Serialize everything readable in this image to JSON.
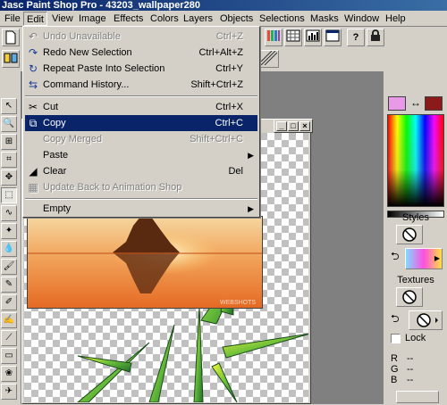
{
  "app": {
    "title": "Jasc Paint Shop Pro - 43203_wallpaper280"
  },
  "menubar": {
    "items": [
      {
        "label": "File"
      },
      {
        "label": "Edit"
      },
      {
        "label": "View"
      },
      {
        "label": "Image"
      },
      {
        "label": "Effects"
      },
      {
        "label": "Colors"
      },
      {
        "label": "Layers"
      },
      {
        "label": "Objects"
      },
      {
        "label": "Selections"
      },
      {
        "label": "Masks"
      },
      {
        "label": "Window"
      },
      {
        "label": "Help"
      }
    ]
  },
  "edit_menu": {
    "items": [
      {
        "label": "Undo Unavailable",
        "shortcut": "Ctrl+Z",
        "icon": "undo-icon",
        "disabled": true
      },
      {
        "label": "Redo New Selection",
        "shortcut": "Ctrl+Alt+Z",
        "icon": "redo-icon"
      },
      {
        "label": "Repeat Paste Into Selection",
        "shortcut": "Ctrl+Y",
        "icon": "repeat-icon"
      },
      {
        "label": "Command History...",
        "shortcut": "Shift+Ctrl+Z",
        "icon": "history-icon"
      },
      {
        "label": "Cut",
        "shortcut": "Ctrl+X",
        "icon": "scissors-icon"
      },
      {
        "label": "Copy",
        "shortcut": "Ctrl+C",
        "icon": "copy-icon",
        "selected": true
      },
      {
        "label": "Copy Merged",
        "shortcut": "Shift+Ctrl+C",
        "icon": "copy-merged-icon",
        "disabled": true
      },
      {
        "label": "Paste",
        "submenu": true
      },
      {
        "label": "Clear",
        "shortcut": "Del",
        "icon": "eraser-icon"
      },
      {
        "label": "Update Back to Animation Shop",
        "icon": "animation-icon",
        "disabled": true
      },
      {
        "label": "Empty",
        "submenu": true
      }
    ]
  },
  "right_panel": {
    "styles_label": "Styles",
    "textures_label": "Textures",
    "lock_label": "Lock",
    "r_label": "R",
    "r_value": "--",
    "g_label": "G",
    "g_value": "--",
    "b_label": "B",
    "b_value": "--"
  },
  "image": {
    "watermark": "WEBSHOTS"
  },
  "colors": {
    "foreground": "#e899e8",
    "background": "#8b1a1a",
    "selection": "#0a246a"
  }
}
